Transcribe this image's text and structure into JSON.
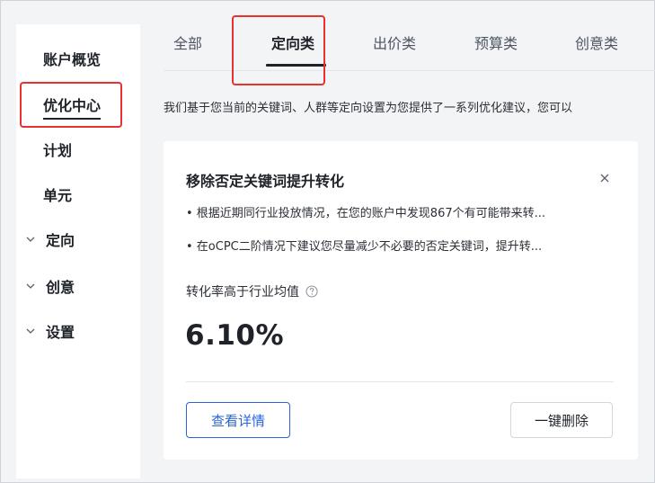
{
  "sidebar": {
    "items": [
      {
        "label": "账户概览",
        "expandable": false
      },
      {
        "label": "优化中心",
        "expandable": false,
        "active": true
      },
      {
        "label": "计划",
        "expandable": false
      },
      {
        "label": "单元",
        "expandable": false
      },
      {
        "label": "定向",
        "expandable": true,
        "icon": "chevron-down-icon"
      },
      {
        "label": "创意",
        "expandable": true,
        "icon": "chevron-down-icon"
      },
      {
        "label": "设置",
        "expandable": true,
        "icon": "chevron-down-icon"
      }
    ]
  },
  "tabs": [
    {
      "label": "全部"
    },
    {
      "label": "定向类",
      "active": true
    },
    {
      "label": "出价类"
    },
    {
      "label": "预算类"
    },
    {
      "label": "创意类"
    }
  ],
  "intro_text": "我们基于您当前的关键词、人群等定向设置为您提供了一系列优化建议，您可以",
  "card": {
    "title": "移除否定关键词提升转化",
    "bullets": [
      "• 根据近期同行业投放情况，在您的账户中发现867个有可能带来转...",
      "• 在oCPC二阶情况下建议您尽量减少不必要的否定关键词，提升转..."
    ],
    "metric_label": "转化率高于行业均值",
    "metric_value": "6.10%",
    "detail_button": "查看详情",
    "delete_button": "一键删除",
    "icons": {
      "close": "close-icon",
      "help": "help-icon"
    }
  },
  "colors": {
    "highlight_box": "#e8322f",
    "primary": "#2a64d8",
    "text": "#1f2329",
    "background": "#f3f4f6"
  }
}
